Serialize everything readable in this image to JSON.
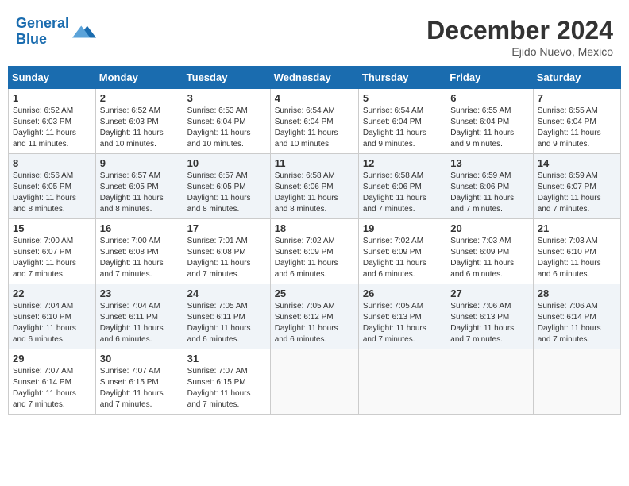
{
  "header": {
    "logo_line1": "General",
    "logo_line2": "Blue",
    "month": "December 2024",
    "location": "Ejido Nuevo, Mexico"
  },
  "weekdays": [
    "Sunday",
    "Monday",
    "Tuesday",
    "Wednesday",
    "Thursday",
    "Friday",
    "Saturday"
  ],
  "weeks": [
    [
      {
        "day": "1",
        "info": "Sunrise: 6:52 AM\nSunset: 6:03 PM\nDaylight: 11 hours\nand 11 minutes."
      },
      {
        "day": "2",
        "info": "Sunrise: 6:52 AM\nSunset: 6:03 PM\nDaylight: 11 hours\nand 10 minutes."
      },
      {
        "day": "3",
        "info": "Sunrise: 6:53 AM\nSunset: 6:04 PM\nDaylight: 11 hours\nand 10 minutes."
      },
      {
        "day": "4",
        "info": "Sunrise: 6:54 AM\nSunset: 6:04 PM\nDaylight: 11 hours\nand 10 minutes."
      },
      {
        "day": "5",
        "info": "Sunrise: 6:54 AM\nSunset: 6:04 PM\nDaylight: 11 hours\nand 9 minutes."
      },
      {
        "day": "6",
        "info": "Sunrise: 6:55 AM\nSunset: 6:04 PM\nDaylight: 11 hours\nand 9 minutes."
      },
      {
        "day": "7",
        "info": "Sunrise: 6:55 AM\nSunset: 6:04 PM\nDaylight: 11 hours\nand 9 minutes."
      }
    ],
    [
      {
        "day": "8",
        "info": "Sunrise: 6:56 AM\nSunset: 6:05 PM\nDaylight: 11 hours\nand 8 minutes."
      },
      {
        "day": "9",
        "info": "Sunrise: 6:57 AM\nSunset: 6:05 PM\nDaylight: 11 hours\nand 8 minutes."
      },
      {
        "day": "10",
        "info": "Sunrise: 6:57 AM\nSunset: 6:05 PM\nDaylight: 11 hours\nand 8 minutes."
      },
      {
        "day": "11",
        "info": "Sunrise: 6:58 AM\nSunset: 6:06 PM\nDaylight: 11 hours\nand 8 minutes."
      },
      {
        "day": "12",
        "info": "Sunrise: 6:58 AM\nSunset: 6:06 PM\nDaylight: 11 hours\nand 7 minutes."
      },
      {
        "day": "13",
        "info": "Sunrise: 6:59 AM\nSunset: 6:06 PM\nDaylight: 11 hours\nand 7 minutes."
      },
      {
        "day": "14",
        "info": "Sunrise: 6:59 AM\nSunset: 6:07 PM\nDaylight: 11 hours\nand 7 minutes."
      }
    ],
    [
      {
        "day": "15",
        "info": "Sunrise: 7:00 AM\nSunset: 6:07 PM\nDaylight: 11 hours\nand 7 minutes."
      },
      {
        "day": "16",
        "info": "Sunrise: 7:00 AM\nSunset: 6:08 PM\nDaylight: 11 hours\nand 7 minutes."
      },
      {
        "day": "17",
        "info": "Sunrise: 7:01 AM\nSunset: 6:08 PM\nDaylight: 11 hours\nand 7 minutes."
      },
      {
        "day": "18",
        "info": "Sunrise: 7:02 AM\nSunset: 6:09 PM\nDaylight: 11 hours\nand 6 minutes."
      },
      {
        "day": "19",
        "info": "Sunrise: 7:02 AM\nSunset: 6:09 PM\nDaylight: 11 hours\nand 6 minutes."
      },
      {
        "day": "20",
        "info": "Sunrise: 7:03 AM\nSunset: 6:09 PM\nDaylight: 11 hours\nand 6 minutes."
      },
      {
        "day": "21",
        "info": "Sunrise: 7:03 AM\nSunset: 6:10 PM\nDaylight: 11 hours\nand 6 minutes."
      }
    ],
    [
      {
        "day": "22",
        "info": "Sunrise: 7:04 AM\nSunset: 6:10 PM\nDaylight: 11 hours\nand 6 minutes."
      },
      {
        "day": "23",
        "info": "Sunrise: 7:04 AM\nSunset: 6:11 PM\nDaylight: 11 hours\nand 6 minutes."
      },
      {
        "day": "24",
        "info": "Sunrise: 7:05 AM\nSunset: 6:11 PM\nDaylight: 11 hours\nand 6 minutes."
      },
      {
        "day": "25",
        "info": "Sunrise: 7:05 AM\nSunset: 6:12 PM\nDaylight: 11 hours\nand 6 minutes."
      },
      {
        "day": "26",
        "info": "Sunrise: 7:05 AM\nSunset: 6:13 PM\nDaylight: 11 hours\nand 7 minutes."
      },
      {
        "day": "27",
        "info": "Sunrise: 7:06 AM\nSunset: 6:13 PM\nDaylight: 11 hours\nand 7 minutes."
      },
      {
        "day": "28",
        "info": "Sunrise: 7:06 AM\nSunset: 6:14 PM\nDaylight: 11 hours\nand 7 minutes."
      }
    ],
    [
      {
        "day": "29",
        "info": "Sunrise: 7:07 AM\nSunset: 6:14 PM\nDaylight: 11 hours\nand 7 minutes."
      },
      {
        "day": "30",
        "info": "Sunrise: 7:07 AM\nSunset: 6:15 PM\nDaylight: 11 hours\nand 7 minutes."
      },
      {
        "day": "31",
        "info": "Sunrise: 7:07 AM\nSunset: 6:15 PM\nDaylight: 11 hours\nand 7 minutes."
      },
      {
        "day": "",
        "info": ""
      },
      {
        "day": "",
        "info": ""
      },
      {
        "day": "",
        "info": ""
      },
      {
        "day": "",
        "info": ""
      }
    ]
  ]
}
